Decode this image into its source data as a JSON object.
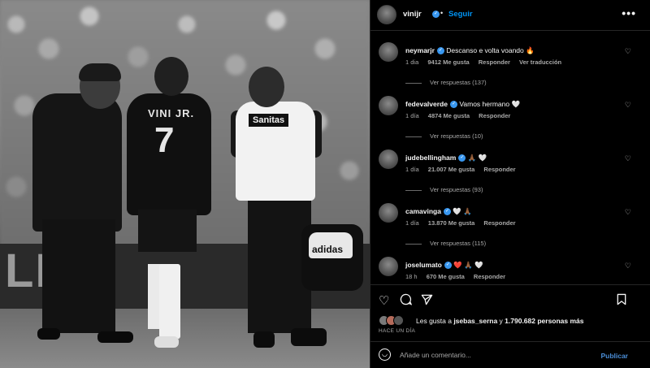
{
  "photo": {
    "jersey_name": "VINI JR.",
    "jersey_number": "7",
    "shirt_sponsor": "Sanitas",
    "bag_brand": "adidas",
    "board_text": "LIG"
  },
  "header": {
    "username": "vinijr",
    "verified": "✓",
    "separator": "•",
    "follow_label": "Seguir",
    "more_label": "•••"
  },
  "comments": [
    {
      "username": "neymarjr",
      "verified": "✓",
      "text": "Descanso e volta voando 🔥",
      "time": "1 dia",
      "likes": "9412 Me gusta",
      "reply_label": "Responder",
      "translate_label": "Ver traducción",
      "replies": "Ver respuestas (137)"
    },
    {
      "username": "fedevalverde",
      "verified": "✓",
      "text": "Vamos hermano 🤍",
      "time": "1 día",
      "likes": "4874 Me gusta",
      "reply_label": "Responder",
      "replies": "Ver respuestas (10)"
    },
    {
      "username": "judebellingham",
      "verified": "✓",
      "text": "🙏🏾 🤍",
      "time": "1 día",
      "likes": "21.007 Me gusta",
      "reply_label": "Responder",
      "replies": "Ver respuestas (93)"
    },
    {
      "username": "camavinga",
      "verified": "✓",
      "text": "🤍 🙏🏾",
      "time": "1 día",
      "likes": "13.870 Me gusta",
      "reply_label": "Responder",
      "replies": "Ver respuestas (115)"
    },
    {
      "username": "joselumato",
      "verified": "✓",
      "text": "❤️ 🙏🏾 🤍",
      "time": "18 h",
      "likes": "670 Me gusta",
      "reply_label": "Responder"
    }
  ],
  "likes_line": {
    "prefix": "Les gusta a ",
    "user": "jsebas_serna",
    "middle": " y ",
    "count": "1.790.682 personas más"
  },
  "posted_ago": "HACE UN DÍA",
  "composer": {
    "placeholder": "Añade un comentario...",
    "publish_label": "Publicar"
  },
  "icons": [
    "heart-icon",
    "comment-icon",
    "share-icon",
    "bookmark-icon",
    "emoji-icon",
    "more-icon",
    "verified-badge-icon"
  ],
  "colors": {
    "accent": "#0095f6",
    "verified": "#3897f0",
    "background": "#000000",
    "muted": "#a8a8a8"
  }
}
